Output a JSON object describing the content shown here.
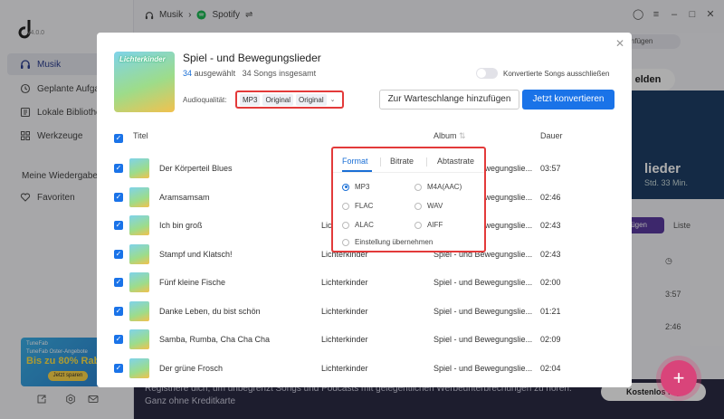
{
  "app": {
    "version": "v4.0.0",
    "breadcrumb": {
      "music": "Musik",
      "service": "Spotify"
    },
    "sidebar": {
      "items": [
        {
          "label": "Musik"
        },
        {
          "label": "Geplante Aufga"
        },
        {
          "label": "Lokale Bibliothe"
        },
        {
          "label": "Werkzeuge"
        }
      ],
      "section_title": "Meine Wiedergabe",
      "favorites": "Favoriten",
      "promo": {
        "brand": "TuneFab",
        "line": "TuneFab Oster-Angebote",
        "headline": "Bis zu 80% Raba",
        "cta": "Jetzt sparen"
      }
    },
    "background": {
      "link_button": "nk einfügen",
      "hero_pill": "elden",
      "hero_title": "lieder",
      "hero_sub": "Std. 33 Min.",
      "add_button": "fügen",
      "list_label": "Liste",
      "durations": [
        "3:57",
        "2:46"
      ],
      "banner_text": "Registriere dich, um unbegrenzt Songs und Podcasts mit gelegentlichen Werbeunterbrechungen zu hören. Ganz ohne Kreditkarte",
      "banner_button": "Kostenlos reg"
    }
  },
  "dialog": {
    "title": "Spiel - und Bewegungslieder",
    "selected_count": "34",
    "selected_label": "ausgewählt",
    "total_label": "34 Songs insgesamt",
    "cover_text": "Lichterkinder",
    "toggle_label": "Konvertierte Songs ausschließen",
    "audio_quality_label": "Audioqualität:",
    "audio_quality": {
      "format": "MP3",
      "bitrate": "Original",
      "samplerate": "Original"
    },
    "queue_button": "Zur Warteschlange hinzufügen",
    "convert_button": "Jetzt konvertieren",
    "columns": {
      "title": "Titel",
      "album": "Album",
      "duration": "Dauer"
    },
    "rows": [
      {
        "title": "Der Körperteil Blues",
        "artist": "",
        "album": "Spiel - und Bewegungslie...",
        "duration": "03:57"
      },
      {
        "title": "Aramsamsam",
        "artist": "",
        "album": "Spiel - und Bewegungslie...",
        "duration": "02:46"
      },
      {
        "title": "Ich bin groß",
        "artist": "Lichterkinder",
        "album": "Spiel - und Bewegungslie...",
        "duration": "02:43"
      },
      {
        "title": "Stampf und Klatsch!",
        "artist": "Lichterkinder",
        "album": "Spiel - und Bewegungslie...",
        "duration": "02:43"
      },
      {
        "title": "Fünf kleine Fische",
        "artist": "Lichterkinder",
        "album": "Spiel - und Bewegungslie...",
        "duration": "02:00"
      },
      {
        "title": "Danke Leben, du bist schön",
        "artist": "Lichterkinder",
        "album": "Spiel - und Bewegungslie...",
        "duration": "01:21"
      },
      {
        "title": "Samba, Rumba, Cha Cha Cha",
        "artist": "Lichterkinder",
        "album": "Spiel - und Bewegungslie...",
        "duration": "02:09"
      },
      {
        "title": "Der grüne Frosch",
        "artist": "Lichterkinder",
        "album": "Spiel - und Bewegungslie...",
        "duration": "02:04"
      }
    ],
    "format_popup": {
      "tabs": [
        "Format",
        "Bitrate",
        "Abtastrate"
      ],
      "options": [
        {
          "label": "MP3",
          "selected": true
        },
        {
          "label": "M4A(AAC)",
          "selected": false
        },
        {
          "label": "FLAC",
          "selected": false
        },
        {
          "label": "WAV",
          "selected": false
        },
        {
          "label": "ALAC",
          "selected": false
        },
        {
          "label": "AIFF",
          "selected": false
        }
      ],
      "apply_all": "Einstellung übernehmen"
    }
  },
  "colors": {
    "accent": "#1a73e8",
    "highlight": "#e33a3a",
    "fab": "#d9447a"
  }
}
